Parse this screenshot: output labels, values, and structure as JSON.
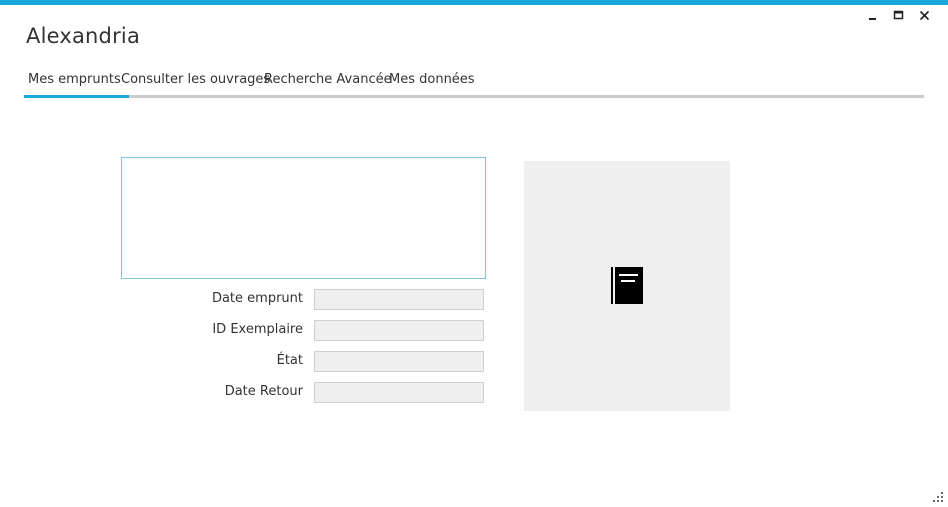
{
  "window": {
    "title": "Alexandria",
    "accent_color": "#19a6d8",
    "controls": {
      "minimize_icon": "minimize-icon",
      "maximize_icon": "maximize-icon",
      "close_icon": "close-icon"
    }
  },
  "tabs": [
    {
      "label": "Mes emprunts",
      "active": true
    },
    {
      "label": "Consulter les ouvrages",
      "active": false
    },
    {
      "label": "Recherche Avancée",
      "active": false
    },
    {
      "label": "Mes données",
      "active": false
    }
  ],
  "loan_list": {
    "items": []
  },
  "details": {
    "date_emprunt": {
      "label": "Date emprunt",
      "value": ""
    },
    "id_exemplaire": {
      "label": "ID Exemplaire",
      "value": ""
    },
    "etat": {
      "label": "État",
      "value": ""
    },
    "date_retour": {
      "label": "Date Retour",
      "value": ""
    }
  },
  "cover": {
    "icon": "book-icon"
  }
}
